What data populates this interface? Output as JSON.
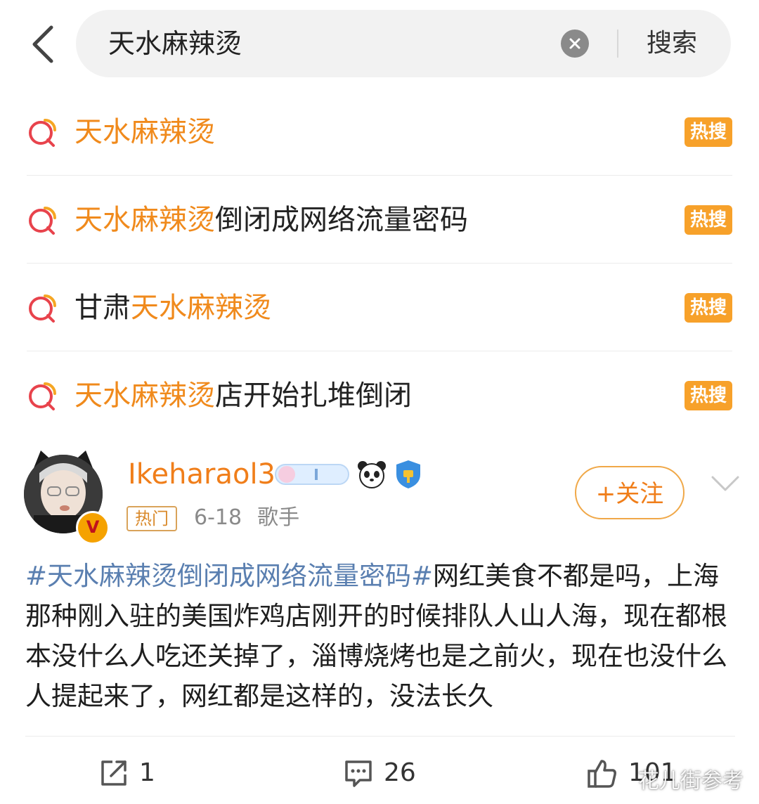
{
  "search": {
    "query": "天水麻辣烫",
    "submit_label": "搜索"
  },
  "suggestions": [
    {
      "highlight": "天水麻辣烫",
      "prefix": "",
      "suffix": "",
      "badge": "热搜"
    },
    {
      "highlight": "天水麻辣烫",
      "prefix": "",
      "suffix": "倒闭成网络流量密码",
      "badge": "热搜"
    },
    {
      "highlight": "天水麻辣烫",
      "prefix": "甘肃",
      "suffix": "",
      "badge": "热搜"
    },
    {
      "highlight": "天水麻辣烫",
      "prefix": "",
      "suffix": "店开始扎堆倒闭",
      "badge": "热搜"
    }
  ],
  "post": {
    "username": "Ikeharaol3",
    "tag": "热门",
    "date": "6-18",
    "source": "歌手",
    "follow_label": "+关注",
    "topic": "#天水麻辣烫倒闭成网络流量密码#",
    "body": "网红美食不都是吗，上海那种刚入驻的美国炸鸡店刚开的时候排队人山人海，现在都根本没什么人吃还关掉了，淄博烧烤也是之前火，现在也没什么人提起来了，网红都是这样的，没法长久",
    "repost_count": "1",
    "comment_count": "26",
    "like_count": "101"
  },
  "watermark": "花儿街参考",
  "colors": {
    "highlight": "#f08a1c",
    "hot_badge": "#f7a12a",
    "topic_link": "#5a7fb0",
    "username": "#f07e1a"
  }
}
